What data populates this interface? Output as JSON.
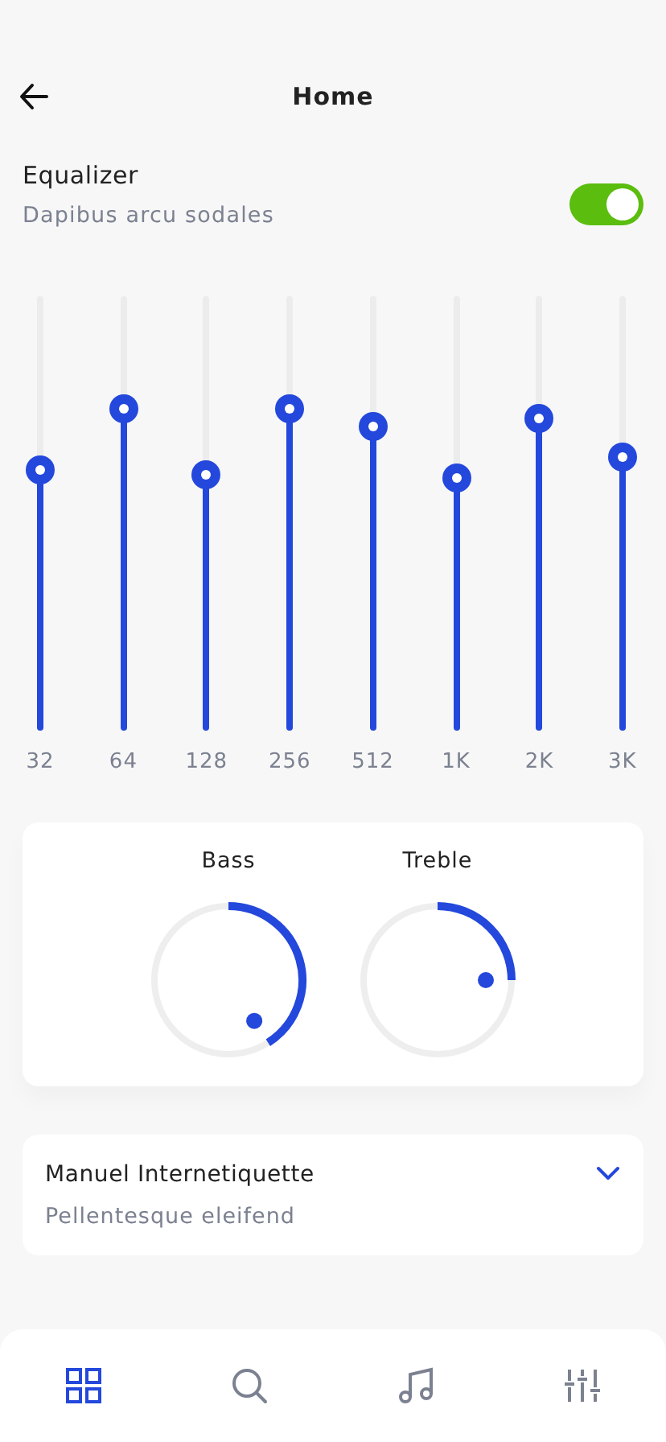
{
  "header": {
    "title": "Home"
  },
  "equalizer": {
    "title": "Equalizer",
    "subtitle": "Dapibus arcu sodales",
    "on": true
  },
  "bands": [
    {
      "label": "32",
      "level": 0.6
    },
    {
      "label": "64",
      "level": 0.74
    },
    {
      "label": "128",
      "level": 0.59
    },
    {
      "label": "256",
      "level": 0.74
    },
    {
      "label": "512",
      "level": 0.7
    },
    {
      "label": "1K",
      "level": 0.58
    },
    {
      "label": "2K",
      "level": 0.72
    },
    {
      "label": "3K",
      "level": 0.63
    }
  ],
  "knobs": [
    {
      "label": "Bass"
    },
    {
      "label": "Treble"
    }
  ],
  "preset": {
    "title": "Manuel Internetiquette",
    "subtitle": "Pellentesque eleifend",
    "expanded": false
  },
  "nav": [
    {
      "kind": "grid",
      "selected": true
    },
    {
      "kind": "search",
      "selected": false
    },
    {
      "kind": "music",
      "selected": false
    },
    {
      "kind": "sliders",
      "selected": false
    }
  ]
}
